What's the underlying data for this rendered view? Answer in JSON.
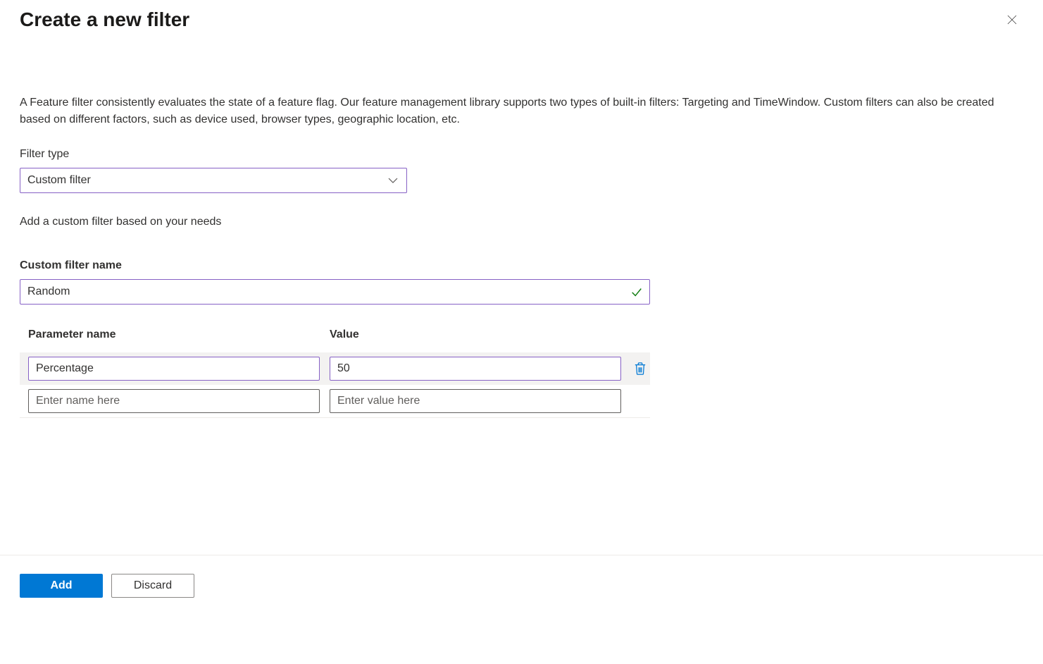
{
  "header": {
    "title": "Create a new filter"
  },
  "description": "A Feature filter consistently evaluates the state of a feature flag. Our feature management library supports two types of built-in filters: Targeting and TimeWindow. Custom filters can also be created based on different factors, such as device used, browser types, geographic location, etc.",
  "filterType": {
    "label": "Filter type",
    "value": "Custom filter"
  },
  "helperText": "Add a custom filter based on your needs",
  "customFilterName": {
    "label": "Custom filter name",
    "value": "Random"
  },
  "paramsTable": {
    "headers": {
      "name": "Parameter name",
      "value": "Value"
    },
    "rows": [
      {
        "name": "Percentage",
        "value": "50"
      }
    ],
    "placeholders": {
      "name": "Enter name here",
      "value": "Enter value here"
    }
  },
  "footer": {
    "add": "Add",
    "discard": "Discard"
  }
}
